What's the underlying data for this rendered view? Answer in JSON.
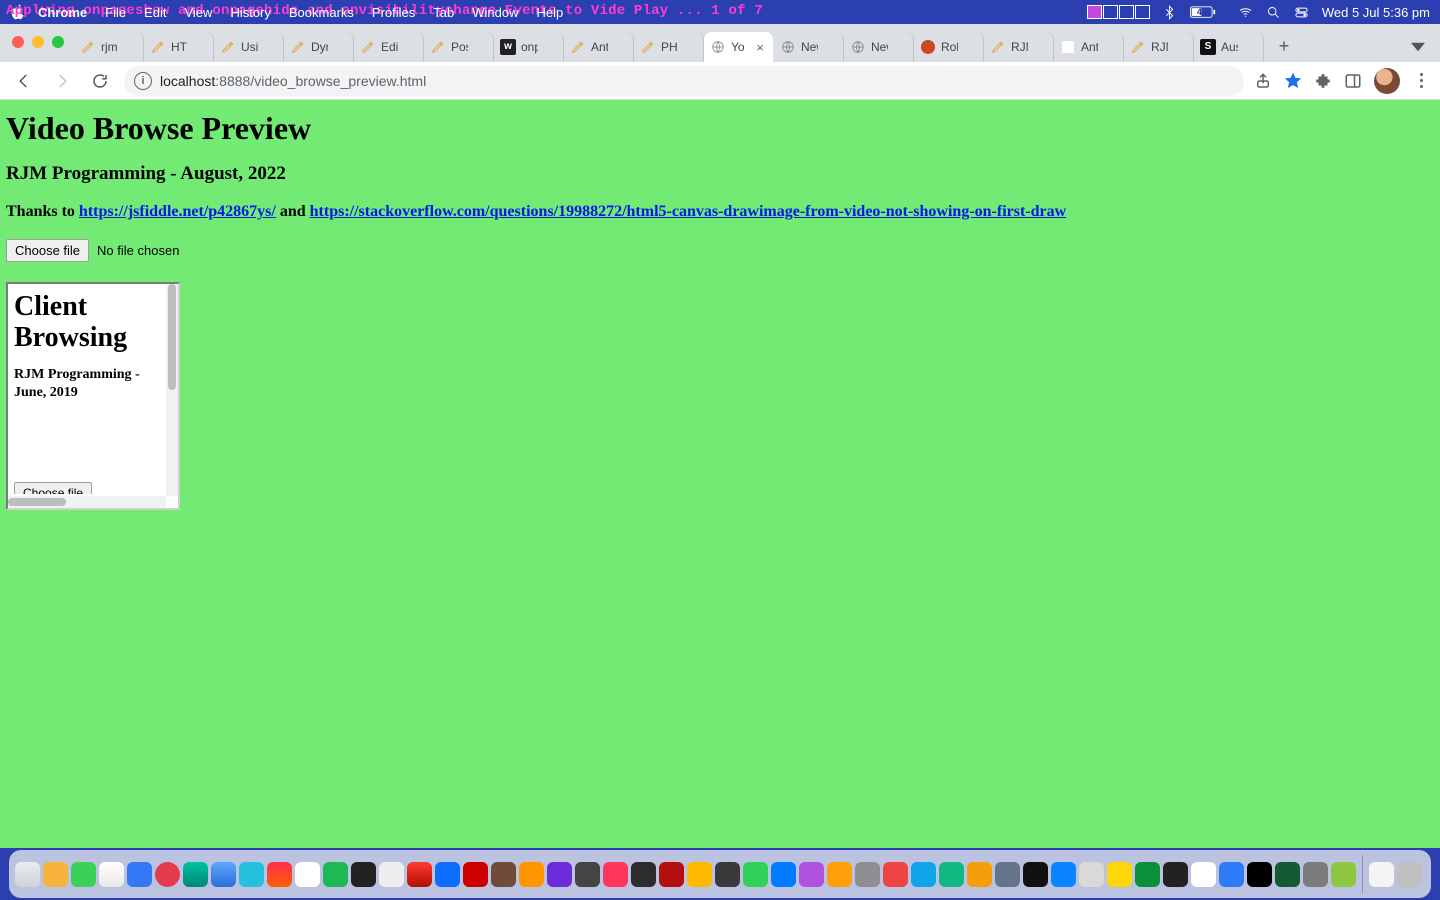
{
  "menubar": {
    "app": "Chrome",
    "items": [
      "File",
      "Edit",
      "View",
      "History",
      "Bookmarks",
      "Profiles",
      "Tab",
      "Window",
      "Help"
    ],
    "overlay": "Applying onpageshow and onpagehide and onvisibilitychange Events to Vide Play ... 1 of 7",
    "clock": "Wed 5 Jul  5:36 pm",
    "battery_text": "48"
  },
  "tabs": [
    {
      "label": "rjmpr",
      "fav": "pencil"
    },
    {
      "label": "HTML",
      "fav": "pencil"
    },
    {
      "label": "Using",
      "fav": "pencil"
    },
    {
      "label": "Dyna",
      "fav": "pencil"
    },
    {
      "label": "Edit P",
      "fav": "pencil"
    },
    {
      "label": "Posts",
      "fav": "pencil"
    },
    {
      "label": "onpla",
      "fav": "w"
    },
    {
      "label": "Ants",
      "fav": "pencil"
    },
    {
      "label": "PHP F",
      "fav": "pencil"
    },
    {
      "label": "Yo",
      "fav": "globe",
      "active": true
    },
    {
      "label": "New",
      "fav": "globe"
    },
    {
      "label": "New",
      "fav": "globe"
    },
    {
      "label": "Rober",
      "fav": "orange"
    },
    {
      "label": "RJM",
      "fav": "pencil"
    },
    {
      "label": "Ants",
      "fav": "blank"
    },
    {
      "label": "RJM F",
      "fav": "pencil"
    },
    {
      "label": "Austr",
      "fav": "s"
    }
  ],
  "omnibox": {
    "host": "localhost",
    "port": ":8888",
    "path": "/video_browse_preview.html"
  },
  "page": {
    "h1": "Video Browse Preview",
    "h2": "RJM Programming - August, 2022",
    "thanks_lead": "Thanks to ",
    "link1": "https://jsfiddle.net/p42867ys/",
    "mid": " and ",
    "link2": "https://stackoverflow.com/questions/19988272/html5-canvas-drawimage-from-video-not-showing-on-first-draw",
    "choose_btn": "Choose file",
    "choose_txt": "No file chosen"
  },
  "iframe": {
    "h1": "Client Browsing",
    "sub": "RJM Programming - June, 2019",
    "choose_btn": "Choose file"
  }
}
